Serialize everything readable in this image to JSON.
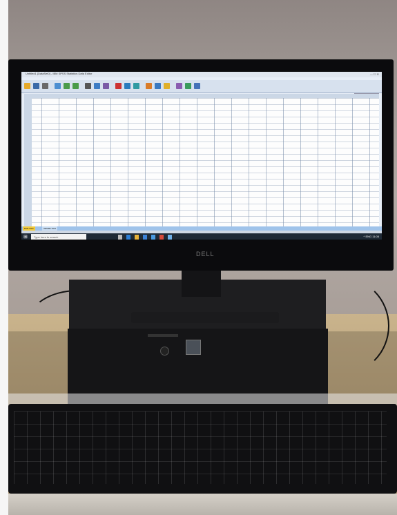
{
  "monitor": {
    "brand": "DELL"
  },
  "screen": {
    "window_title": "Untitled1 [DataSet0] - IBM SPSS Statistics Data Editor",
    "window_controls": "— ☐ ✕",
    "tabs": [
      {
        "label": "Data View"
      },
      {
        "label": "Variable View"
      }
    ],
    "taskbar": {
      "search_placeholder": "Type here to search",
      "tray_text": "^ ENG 11:05"
    }
  },
  "colors": {
    "screen_bg": "#e7eef7",
    "taskbar": "#1f2a36",
    "tab_bar": "#9fc3ea"
  }
}
